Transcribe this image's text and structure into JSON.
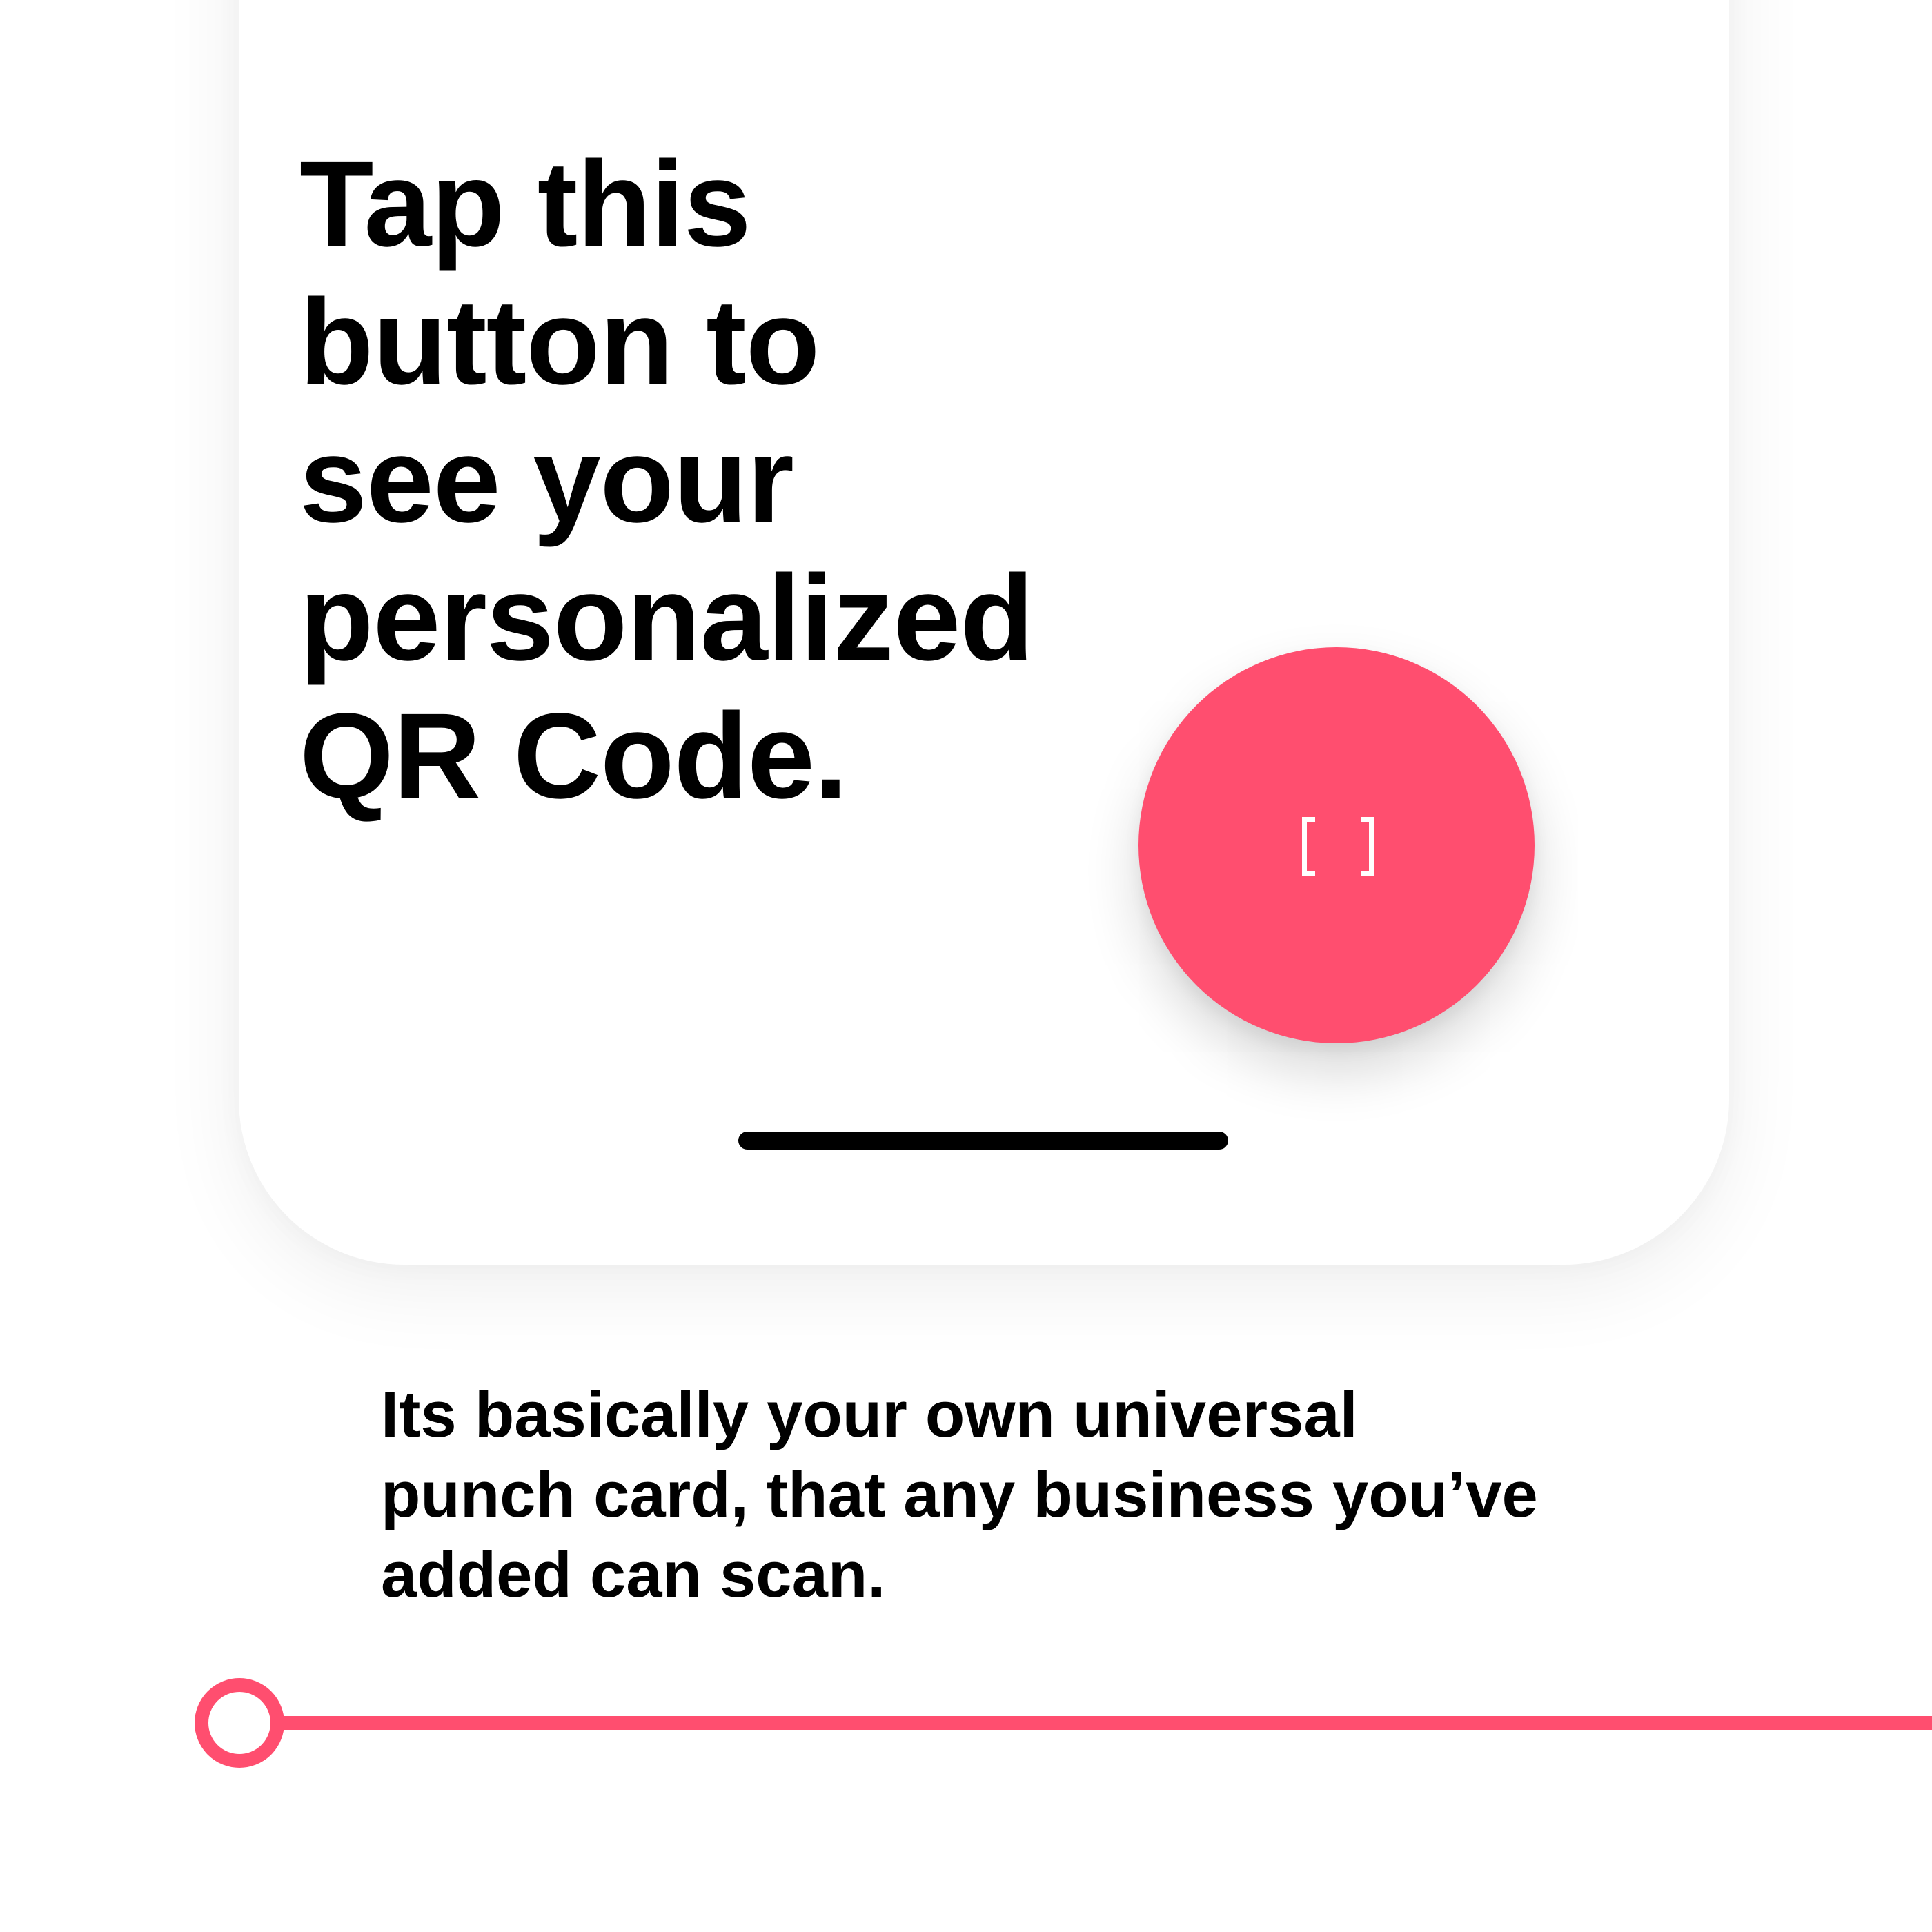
{
  "screen": {
    "headline_lines": [
      "Tap this",
      "button to",
      "see your",
      "personalized",
      "QR Code."
    ],
    "qr_button": {
      "icon": "qr-scan-icon",
      "color": "#ff4e6f"
    }
  },
  "caption": {
    "lines": [
      "Its basically your own universal",
      "punch card, that any business you’ve",
      "added can scan."
    ]
  },
  "progress": {
    "color": "#ff4e6f"
  }
}
